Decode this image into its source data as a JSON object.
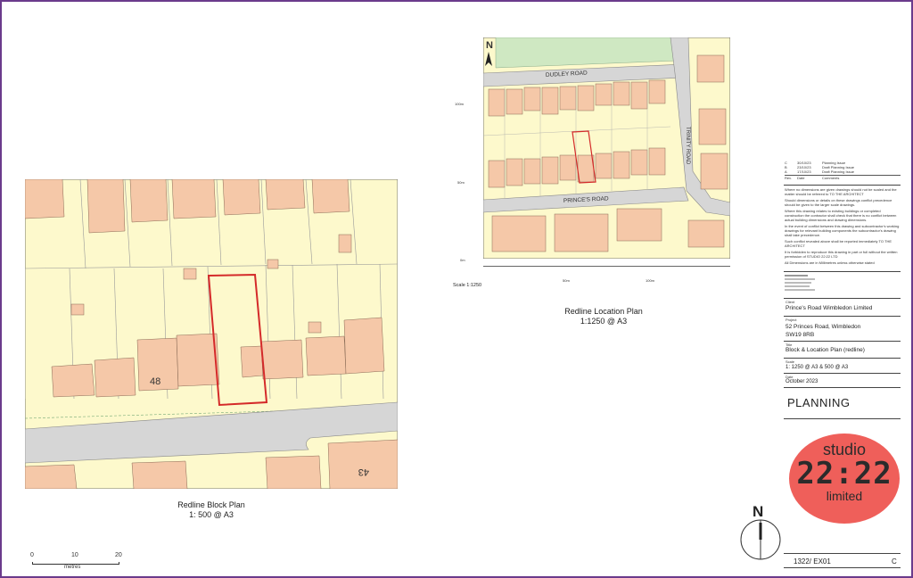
{
  "block_plan": {
    "caption_title": "Redline Block Plan",
    "caption_scale": "1: 500 @ A3",
    "labels": {
      "house_48": "48",
      "house_43": "43"
    }
  },
  "location_plan": {
    "caption_title": "Redline Location Plan",
    "caption_scale": "1:1250 @ A3",
    "scale_note": "Scale 1:1250",
    "roads": {
      "north": "DUDLEY ROAD",
      "south": "PRINCE'S ROAD",
      "east": "TRINITY ROAD"
    },
    "axis_labels": {
      "y1": "100m",
      "y2": "50m",
      "y3": "0m",
      "x1": "50m",
      "x2": "100m"
    }
  },
  "scale_bar": {
    "ticks": [
      "0",
      "10",
      "20"
    ],
    "unit": "metres"
  },
  "title_block": {
    "revisions": [
      {
        "rev": "C",
        "date": "30/10/23",
        "comment": "Planning Issue"
      },
      {
        "rev": "B",
        "date": "23/10/23",
        "comment": "Draft Planning Issue"
      },
      {
        "rev": "A",
        "date": "17/10/23",
        "comment": "Draft Planning Issue"
      }
    ],
    "rev_headers": {
      "rev": "Rev.",
      "date": "Date",
      "comment": "Comments"
    },
    "notes": [
      "Where no dimensions are given drawings should not be scaled and the matter should be referred to TO THE ARCHITECT",
      "Should dimensions or details on these drawings conflict precedence should be given to the larger scale drawings.",
      "Where this drawing relates to existing buildings or completed construction the contractor shall check that there is no conflict between actual building dimensions and drawing dimensions.",
      "In the event of conflict between this drawing and subcontractor's working drawings for relevant building components the subcontractor's drawing shall take precedence.",
      "Such conflict revealed above shall be reported immediately TO THE ARCHITECT",
      "It is forbidden to reproduce this drawing in part or full without the written permission of STUDIO 22:22 LTD",
      "All Dimensions are in Millimetres unless otherwise stated"
    ],
    "client_label": "Client",
    "client": "Prince's Road Wimbledon Limited",
    "project_label": "Project",
    "project_line1": "52 Princes Road, Wimbledon",
    "project_line2": "SW19 8RB",
    "title_label": "Title",
    "title": "Block & Location Plan (redline)",
    "scale_label": "Scale",
    "scale": "1: 1250 @ A3 & 500 @ A3",
    "date_label": "Date",
    "date": "October 2023",
    "status": "PLANNING",
    "drawing_no": "1322/ EX01",
    "revision": "C"
  },
  "logo": {
    "line1": "studio",
    "line2": "22:22",
    "line3": "limited",
    "color": "#ef5f5a"
  },
  "north_arrow": {
    "label": "N"
  },
  "colors": {
    "redline": "#d42a2a",
    "border": "#6b3b8c",
    "building": "#f5c8a8",
    "plot": "#fdf9cc",
    "road": "#d6d6d6"
  }
}
